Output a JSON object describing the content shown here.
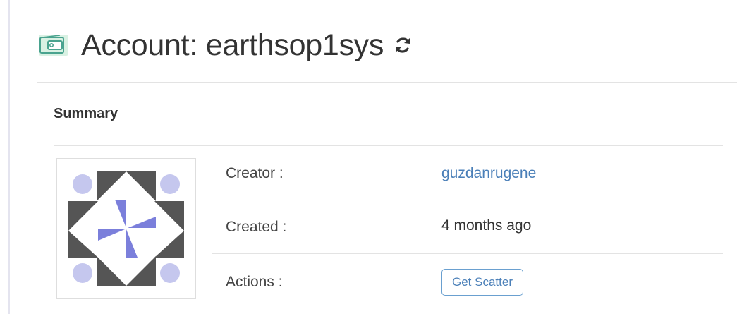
{
  "header": {
    "title_label": "Account:",
    "account_name": "earthsop1sys",
    "icon": "wallet-icon",
    "refresh_icon": "refresh-icon",
    "icon_color": "#4aa38f",
    "icon_bg": "#d9f1e3"
  },
  "summary": {
    "section_title": "Summary",
    "avatar": {
      "icon": "identicon-avatar",
      "colors": {
        "dark": "#555555",
        "accent": "#7b7fdb",
        "light": "#c5c7ee"
      }
    },
    "rows": [
      {
        "label": "Creator :",
        "value": "guzdanrugene"
      },
      {
        "label": "Created :",
        "value": "4 months ago"
      },
      {
        "label": "Actions :",
        "button": "Get Scatter"
      }
    ],
    "link_color": "#4a7fb8"
  }
}
